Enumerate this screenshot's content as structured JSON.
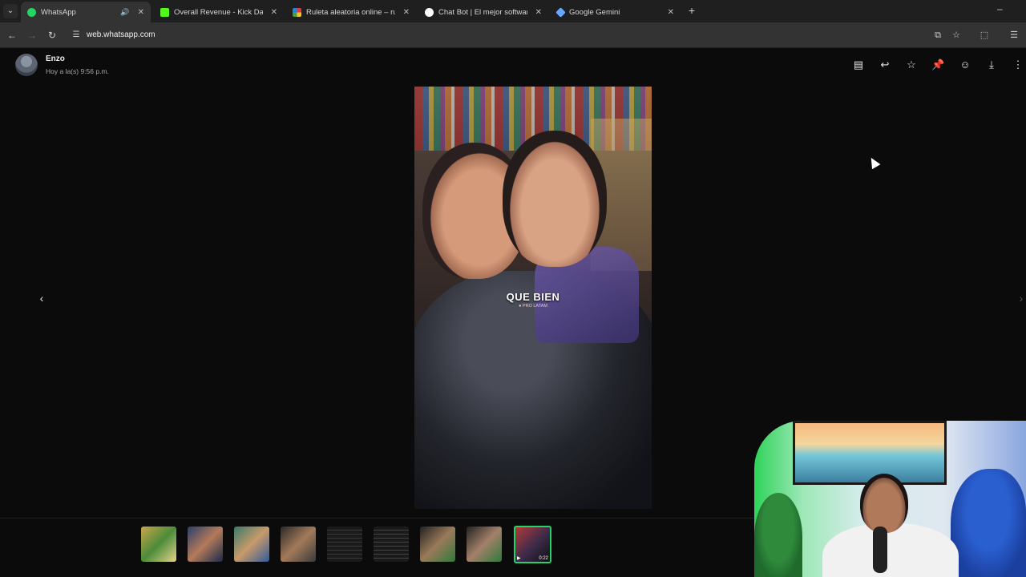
{
  "browser": {
    "tabs": [
      {
        "title": "WhatsApp",
        "active": true,
        "audio": true,
        "favicon_color": "#25d366"
      },
      {
        "title": "Overall Revenue - Kick Dashbo",
        "active": false,
        "favicon_color": "#53fc18"
      },
      {
        "title": "Ruleta aleatoria online – ruleta",
        "active": false,
        "favicon_color": "#e53935"
      },
      {
        "title": "Chat Bot | El mejor software pa",
        "active": false,
        "favicon_color": "#ffffff"
      },
      {
        "title": "Google Gemini",
        "active": false,
        "favicon_color": "#6aa6ff"
      }
    ],
    "url": "web.whatsapp.com"
  },
  "viewer": {
    "sender_name": "Enzo",
    "sent_time": "Hoy a la(s) 9:56 p.m.",
    "caption": "QUE BIEN",
    "watermark": "● PRO LATAM",
    "toolbar_icons": [
      "message-icon",
      "reply-icon",
      "star-icon",
      "pin-icon",
      "emoji-icon",
      "download-icon",
      "more-icon"
    ],
    "thumbnails": [
      {
        "type": "image",
        "selected": false
      },
      {
        "type": "image",
        "selected": false
      },
      {
        "type": "image",
        "selected": false
      },
      {
        "type": "image",
        "selected": false
      },
      {
        "type": "document",
        "selected": false
      },
      {
        "type": "document",
        "selected": false
      },
      {
        "type": "image",
        "selected": false
      },
      {
        "type": "image",
        "selected": false
      },
      {
        "type": "video",
        "selected": true,
        "duration": "0:22"
      }
    ]
  },
  "colors": {
    "accent": "#25d366",
    "background": "#0b0b0b"
  }
}
